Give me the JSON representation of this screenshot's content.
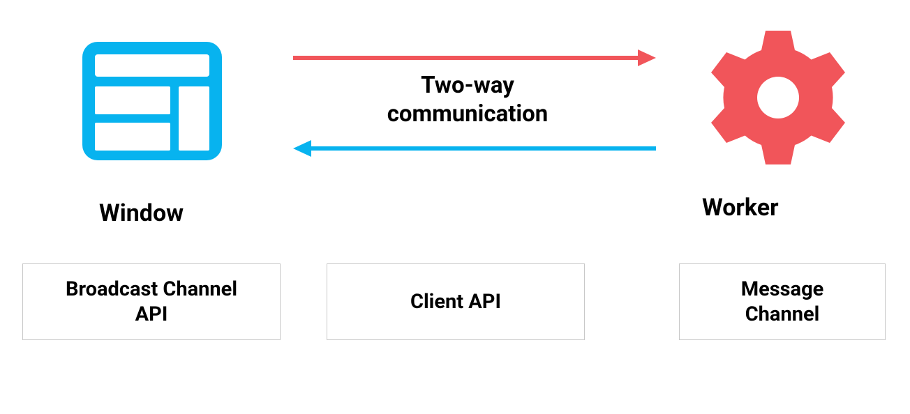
{
  "diagram": {
    "left_node_label": "Window",
    "right_node_label": "Worker",
    "center_label_line1": "Two-way",
    "center_label_line2": "communication",
    "boxes": {
      "broadcast_line1": "Broadcast Channel",
      "broadcast_line2": "API",
      "client": "Client API",
      "message_line1": "Message",
      "message_line2": "Channel"
    },
    "colors": {
      "blue": "#07b3ef",
      "red": "#f1555a",
      "arrow_blue": "#07b3ef",
      "arrow_red": "#f1555a"
    }
  }
}
